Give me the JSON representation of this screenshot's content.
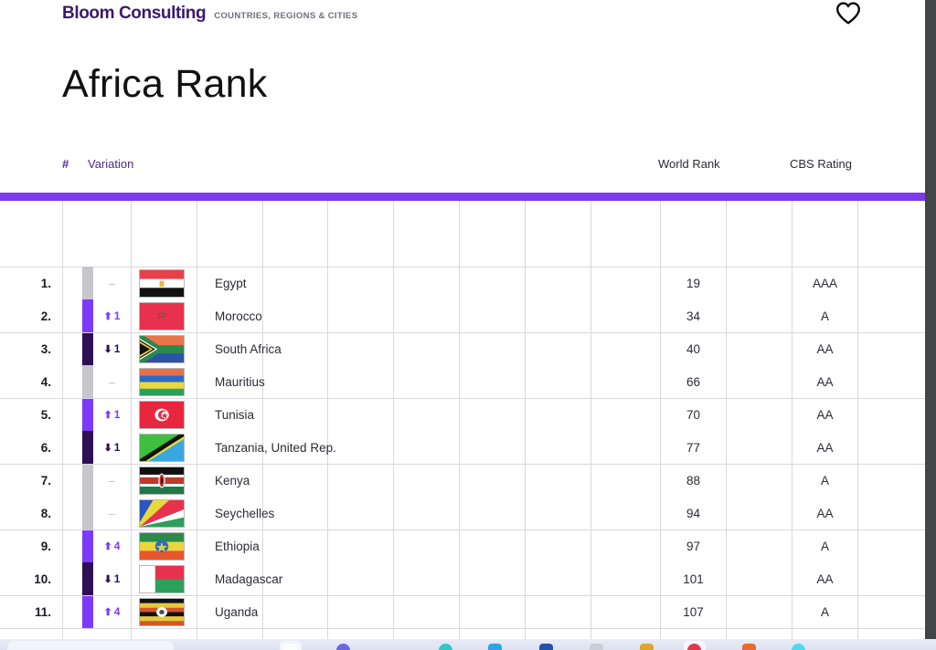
{
  "brand": {
    "name": "Bloom Consulting",
    "tagline": "COUNTRIES, REGIONS & CITIES",
    "favorite_icon": "heart-icon"
  },
  "page": {
    "title": "Africa Rank"
  },
  "table": {
    "headers": {
      "hash": "#",
      "variation": "Variation",
      "world_rank": "World Rank",
      "cbs_rating": "CBS Rating"
    },
    "accent_color": "#7C3AED",
    "bar_colors": {
      "up": "#7C3AFF",
      "down": "#2E0F54",
      "none": "#C6C6CC"
    },
    "rows": [
      {
        "rank": "1.",
        "variation_dir": "none",
        "variation": "–",
        "flag": "flag-egypt",
        "country": "Egypt",
        "world_rank": "19",
        "cbs_rating": "AAA"
      },
      {
        "rank": "2.",
        "variation_dir": "up",
        "variation": "1",
        "flag": "flag-morocco",
        "country": "Morocco",
        "world_rank": "34",
        "cbs_rating": "A"
      },
      {
        "rank": "3.",
        "variation_dir": "down",
        "variation": "1",
        "flag": "flag-south-africa",
        "country": "South Africa",
        "world_rank": "40",
        "cbs_rating": "AA"
      },
      {
        "rank": "4.",
        "variation_dir": "none",
        "variation": "–",
        "flag": "flag-mauritius",
        "country": "Mauritius",
        "world_rank": "66",
        "cbs_rating": "AA"
      },
      {
        "rank": "5.",
        "variation_dir": "up",
        "variation": "1",
        "flag": "flag-tunisia",
        "country": "Tunisia",
        "world_rank": "70",
        "cbs_rating": "AA"
      },
      {
        "rank": "6.",
        "variation_dir": "down",
        "variation": "1",
        "flag": "flag-tanzania",
        "country": "Tanzania, United Rep.",
        "world_rank": "77",
        "cbs_rating": "AA"
      },
      {
        "rank": "7.",
        "variation_dir": "none",
        "variation": "–",
        "flag": "flag-kenya",
        "country": "Kenya",
        "world_rank": "88",
        "cbs_rating": "A"
      },
      {
        "rank": "8.",
        "variation_dir": "none",
        "variation": "–",
        "flag": "flag-seychelles",
        "country": "Seychelles",
        "world_rank": "94",
        "cbs_rating": "AA"
      },
      {
        "rank": "9.",
        "variation_dir": "up",
        "variation": "4",
        "flag": "flag-ethiopia",
        "country": "Ethiopia",
        "world_rank": "97",
        "cbs_rating": "A"
      },
      {
        "rank": "10.",
        "variation_dir": "down",
        "variation": "1",
        "flag": "flag-madagascar",
        "country": "Madagascar",
        "world_rank": "101",
        "cbs_rating": "AA"
      },
      {
        "rank": "11.",
        "variation_dir": "up",
        "variation": "4",
        "flag": "flag-uganda",
        "country": "Uganda",
        "world_rank": "107",
        "cbs_rating": "A"
      }
    ]
  },
  "taskbar": {
    "search_placeholder": ""
  }
}
